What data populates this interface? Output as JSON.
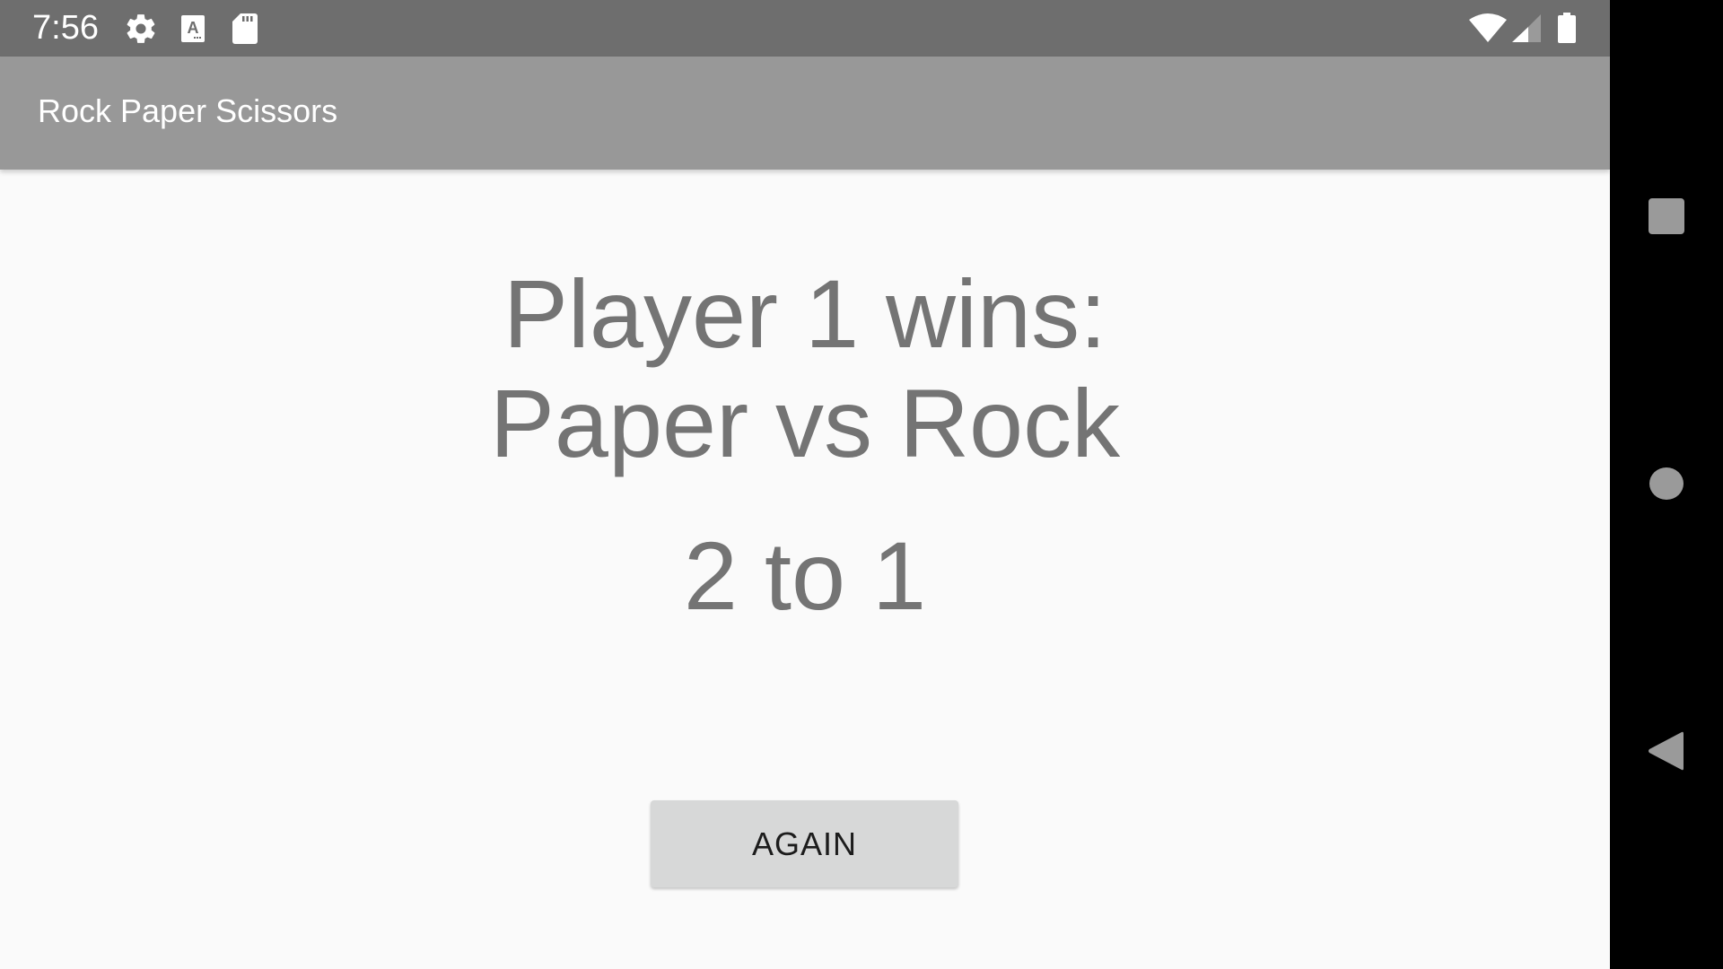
{
  "status_bar": {
    "time": "7:56",
    "left_icons": [
      "settings-icon",
      "keyboard-a-icon",
      "sd-card-icon"
    ],
    "right_icons": [
      "wifi-icon",
      "cell-signal-icon",
      "battery-icon"
    ]
  },
  "app_bar": {
    "title": "Rock Paper Scissors"
  },
  "main": {
    "result_line1": "Player 1 wins:",
    "result_line2": "Paper vs Rock",
    "score": "2 to 1",
    "again_button": "AGAIN"
  },
  "nav_bar": {
    "buttons": [
      "recents",
      "home",
      "back"
    ]
  },
  "colors": {
    "status_bar": "#6e6e6e",
    "app_bar": "#989898",
    "background": "#fafafa",
    "text": "#747474",
    "button": "#d7d8d8",
    "nav_icon": "#9a9a9a"
  }
}
